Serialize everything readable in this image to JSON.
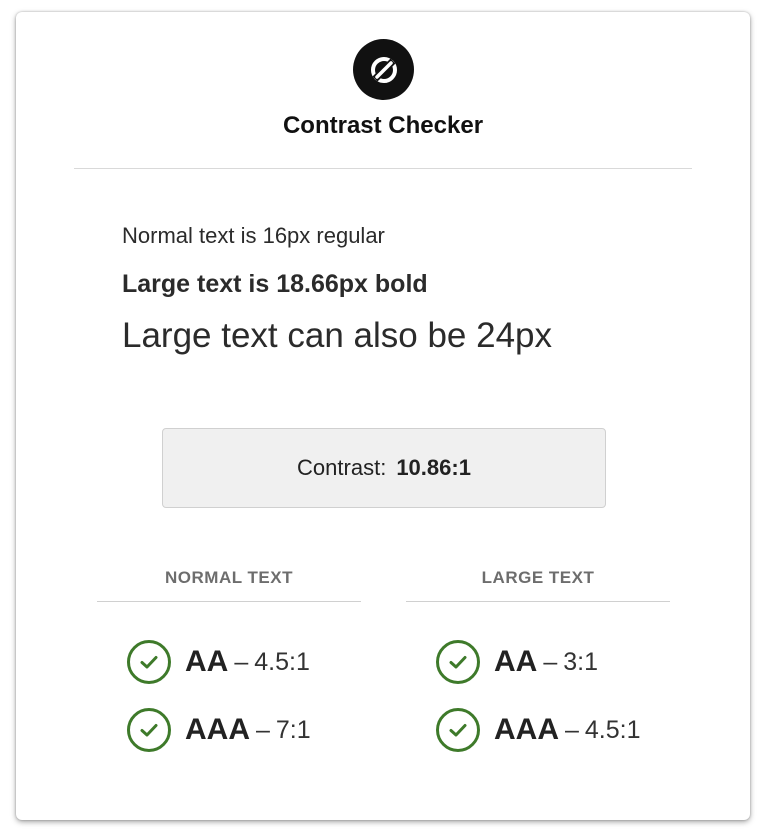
{
  "app": {
    "title": "Contrast Checker",
    "logo_icon": "slashed-circle-icon"
  },
  "samples": {
    "normal": "Normal text is 16px regular",
    "bold": "Large text is 18.66px bold",
    "large": "Large text can also be 24px"
  },
  "contrast": {
    "label": "Contrast:",
    "value": "10.86:1"
  },
  "results": {
    "normal_text": {
      "heading": "NORMAL TEXT",
      "items": [
        {
          "level": "AA",
          "separator": "–",
          "ratio": "4.5:1",
          "status": "pass"
        },
        {
          "level": "AAA",
          "separator": "–",
          "ratio": "7:1",
          "status": "pass"
        }
      ]
    },
    "large_text": {
      "heading": "LARGE TEXT",
      "items": [
        {
          "level": "AA",
          "separator": "–",
          "ratio": "3:1",
          "status": "pass"
        },
        {
          "level": "AAA",
          "separator": "–",
          "ratio": "4.5:1",
          "status": "pass"
        }
      ]
    }
  },
  "colors": {
    "pass": "#3e7a2a",
    "logo_bg": "#111111",
    "box_bg": "#f0f0f0"
  }
}
